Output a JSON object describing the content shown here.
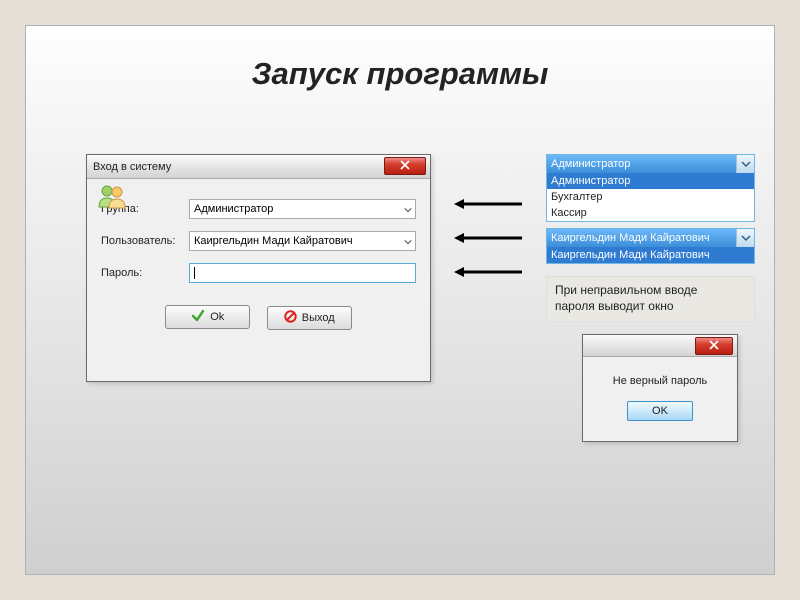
{
  "page": {
    "title": "Запуск программы"
  },
  "login_window": {
    "title": "Вход в систему",
    "labels": {
      "group": "Группа:",
      "user": "Пользователь:",
      "password": "Пароль:"
    },
    "values": {
      "group": "Администратор",
      "user": "Каиргельдин Мади Кайратович",
      "password": ""
    },
    "buttons": {
      "ok": "Ok",
      "exit": "Выход"
    }
  },
  "group_dropdown": {
    "selected": "Администратор",
    "options": [
      "Администратор",
      "Бухгалтер",
      "Кассир"
    ]
  },
  "user_dropdown": {
    "selected": "Каиргельдин Мади Кайратович",
    "options": [
      "Каиргельдин Мади Кайратович"
    ]
  },
  "note": {
    "line1": "При неправильном вводе",
    "line2": "пароля выводит окно"
  },
  "error_dialog": {
    "message": "Не верный пароль",
    "ok": "OK"
  },
  "colors": {
    "highlight": "#2f7bd1",
    "titlebar_close": "#c8341f"
  },
  "icons": {
    "close": "close-icon",
    "users": "users-icon",
    "caret_down": "chevron-down-icon",
    "check": "check-icon",
    "forbidden": "forbidden-icon"
  }
}
